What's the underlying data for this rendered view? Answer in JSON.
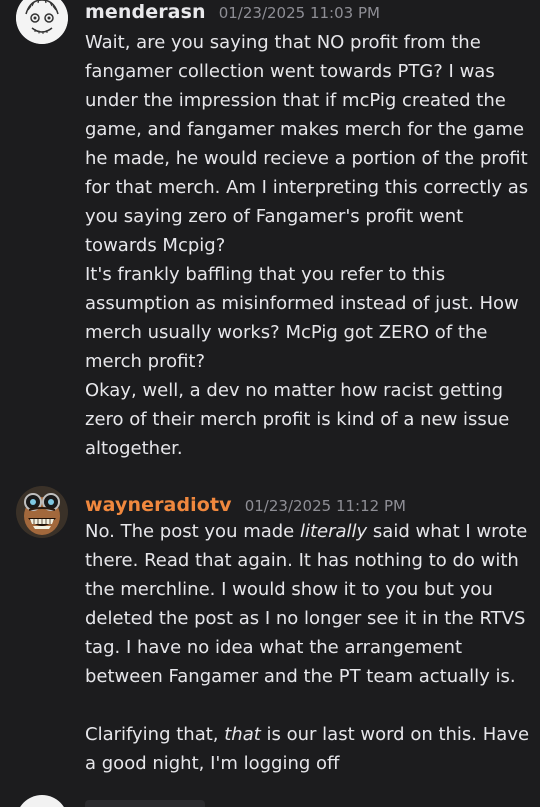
{
  "messages": [
    {
      "username": "menderasn",
      "timestamp": "01/23/2025 11:03 PM",
      "avatar_icon": "sketch-face-avatar",
      "paragraphs": [
        "Wait, are you saying that NO profit from the fangamer collection went towards PTG? I was under the impression that if mcPig created the game, and fangamer makes merch for the game he made, he would recieve a portion of the profit for that merch. Am I interpreting this correctly as you saying zero of Fangamer's profit went towards Mcpig?",
        "It's frankly baffling that you refer to this assumption as misinformed instead of just. How merch usually works? McPig got ZERO of the merch profit?",
        "Okay, well, a dev no matter how racist getting zero of their merch profit is kind of a new issue altogether."
      ]
    },
    {
      "username": "wayneradiotv",
      "timestamp": "01/23/2025 11:12 PM",
      "avatar_icon": "grinning-goggles-avatar",
      "username_color": "#f0883e",
      "p1_a": "No. The post you made ",
      "p1_em": "literally",
      "p1_b": " said what I wrote there. Read that again. It has nothing to do with the merchline. I would show it to you but you deleted the post as I no longer see it in the RTVS tag. I have no idea what the arrangement between Fangamer and the PT team actually is.",
      "p2_a": "Clarifying that, ",
      "p2_em": "that",
      "p2_b": " is our last word on this. Have a good night, I'm logging off"
    }
  ]
}
